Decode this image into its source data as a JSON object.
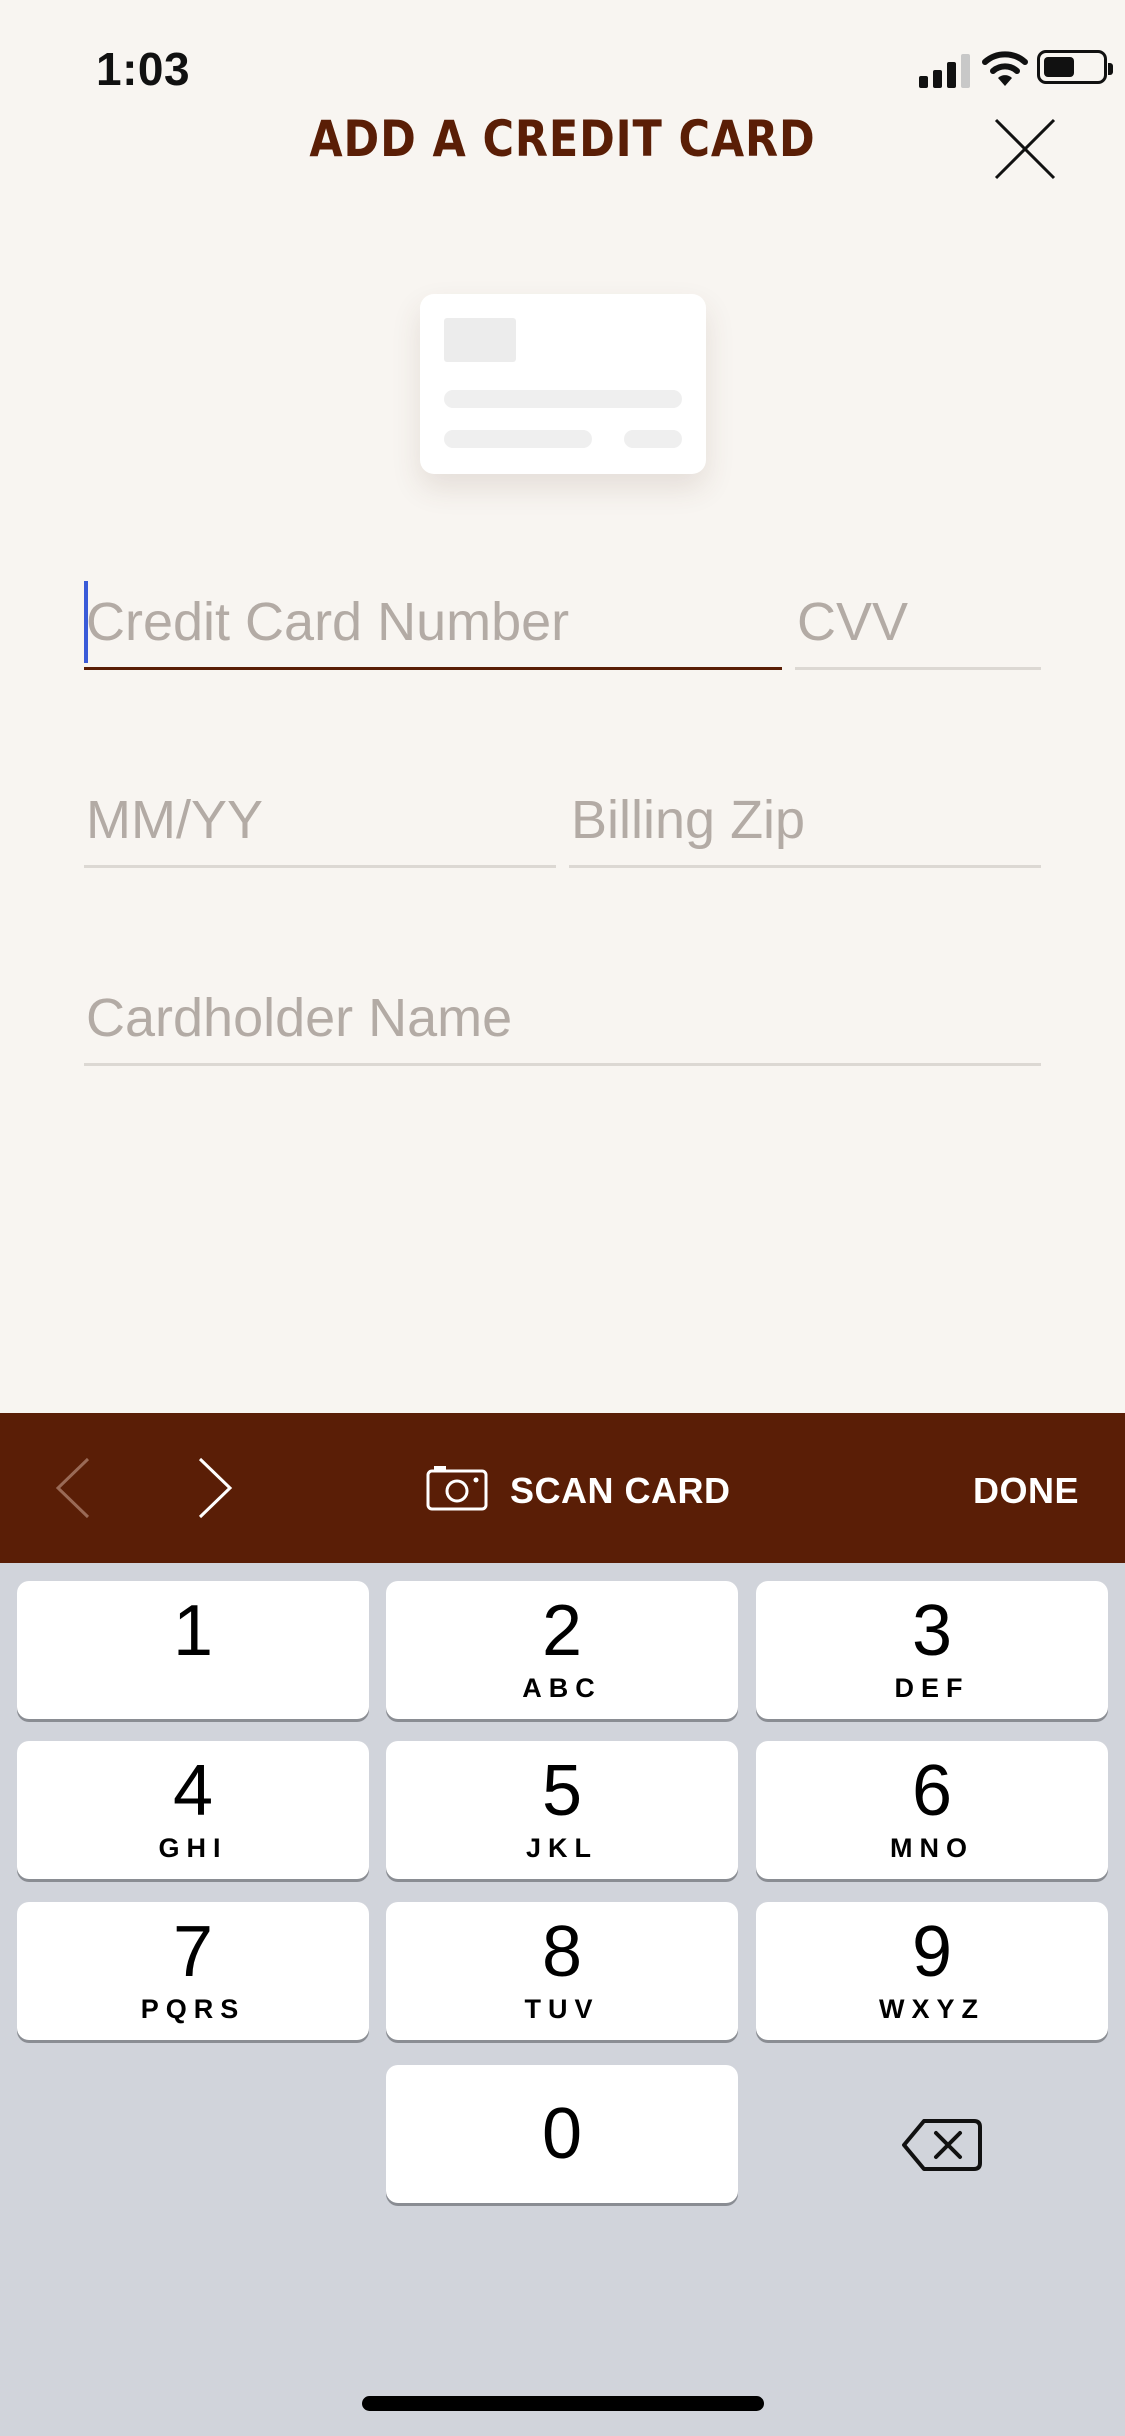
{
  "status_bar": {
    "time": "1:03"
  },
  "header": {
    "title": "ADD A CREDIT CARD",
    "close_icon": "close-icon"
  },
  "form": {
    "card_number": {
      "placeholder": "Credit Card Number",
      "value": ""
    },
    "cvv": {
      "placeholder": "CVV",
      "value": ""
    },
    "expiry": {
      "placeholder": "MM/YY",
      "value": ""
    },
    "billing_zip": {
      "placeholder": "Billing Zip",
      "value": ""
    },
    "cardholder_name": {
      "placeholder": "Cardholder Name",
      "value": ""
    }
  },
  "accessory_bar": {
    "prev_icon": "chevron-left-icon",
    "next_icon": "chevron-right-icon",
    "scan_icon": "camera-icon",
    "scan_label": "SCAN CARD",
    "done_label": "DONE"
  },
  "keypad": {
    "keys": [
      {
        "digit": "1",
        "letters": ""
      },
      {
        "digit": "2",
        "letters": "ABC"
      },
      {
        "digit": "3",
        "letters": "DEF"
      },
      {
        "digit": "4",
        "letters": "GHI"
      },
      {
        "digit": "5",
        "letters": "JKL"
      },
      {
        "digit": "6",
        "letters": "MNO"
      },
      {
        "digit": "7",
        "letters": "PQRS"
      },
      {
        "digit": "8",
        "letters": "TUV"
      },
      {
        "digit": "9",
        "letters": "WXYZ"
      },
      {
        "digit": "0",
        "letters": ""
      }
    ],
    "delete_icon": "backspace-icon"
  },
  "colors": {
    "brand": "#5a1e06",
    "background": "#f8f5f1",
    "placeholder": "#b3aba5",
    "cursor": "#3a5bd8",
    "keyboard": "#d1d4db"
  }
}
